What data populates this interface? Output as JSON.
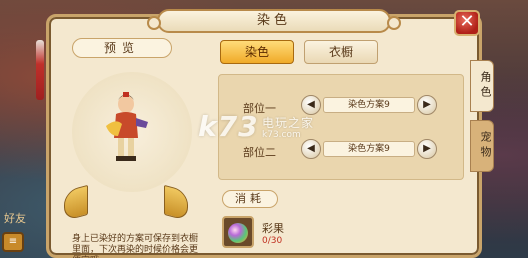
{
  "dialog": {
    "title": "染色",
    "close_icon": "close-icon",
    "close_label": "✕"
  },
  "preview": {
    "label": "预览",
    "description": "身上已染好的方案可保存到衣橱里面，下次再染的时候价格会更便宜哦"
  },
  "tabs": {
    "dye": "染色",
    "wardrobe": "衣橱"
  },
  "slots": [
    {
      "label": "部位一",
      "value": "染色方案9"
    },
    {
      "label": "部位二",
      "value": "染色方案9"
    }
  ],
  "consume": {
    "label": "消耗",
    "item_name": "彩果",
    "item_count": "0/30"
  },
  "side_tabs": {
    "character": "角色",
    "pet": "宠物"
  },
  "background": {
    "chat_tag": "好友"
  },
  "watermark": {
    "logo": "k73",
    "site_name": "电玩之家",
    "url": "k73.com"
  },
  "colors": {
    "panel_bg": "#f4e8cf",
    "accent_gold": "#f0aa28",
    "border": "#c9a46a",
    "close_red": "#b02018",
    "count_red": "#c03020"
  }
}
